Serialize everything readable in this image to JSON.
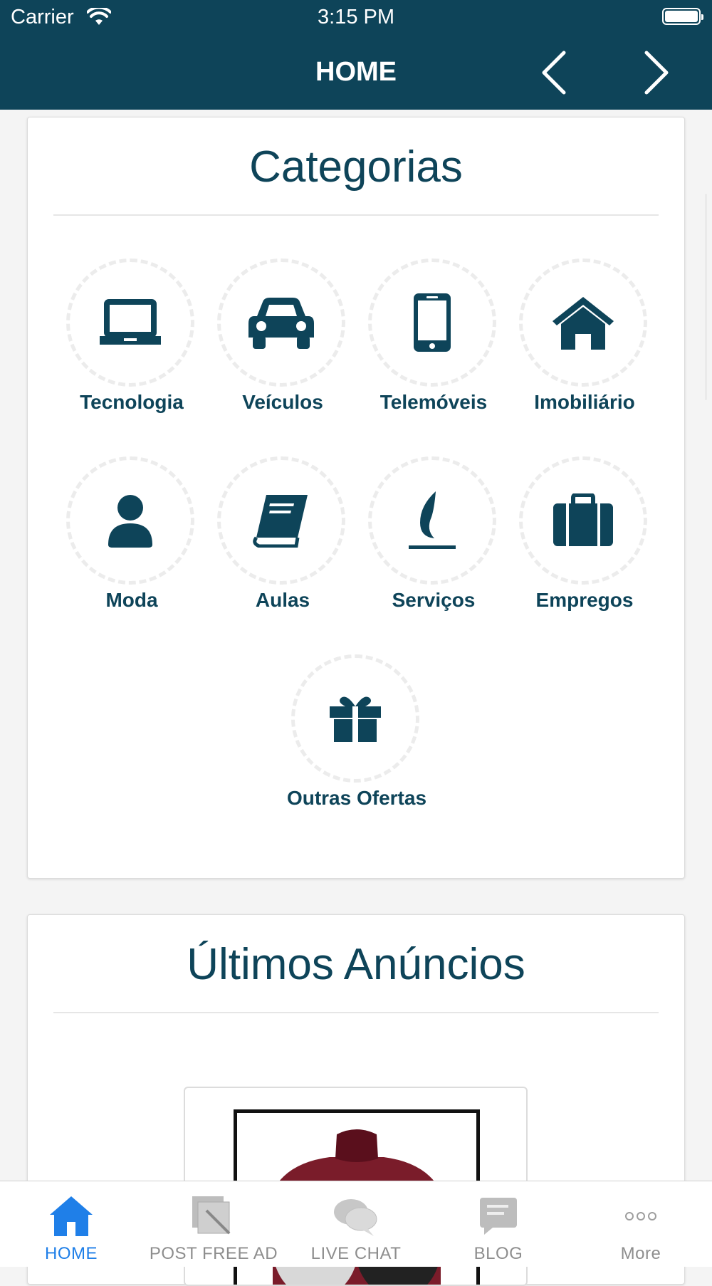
{
  "status_bar": {
    "carrier": "Carrier",
    "time": "3:15 PM"
  },
  "nav": {
    "title": "HOME",
    "prev_icon": "chevron-left-icon",
    "next_icon": "chevron-right-icon"
  },
  "categories": {
    "title": "Categorias",
    "items": [
      {
        "label": "Tecnologia",
        "icon": "laptop-icon"
      },
      {
        "label": "Veículos",
        "icon": "car-icon"
      },
      {
        "label": "Telemóveis",
        "icon": "mobile-phone-icon"
      },
      {
        "label": "Imobiliário",
        "icon": "house-icon"
      },
      {
        "label": "Moda",
        "icon": "user-icon"
      },
      {
        "label": "Aulas",
        "icon": "book-icon"
      },
      {
        "label": "Serviços",
        "icon": "flame-icon"
      },
      {
        "label": "Empregos",
        "icon": "briefcase-icon"
      },
      {
        "label": "Outras Ofertas",
        "icon": "gift-icon"
      }
    ]
  },
  "latest": {
    "title": "Últimos Anúncios"
  },
  "tabbar": {
    "items": [
      {
        "label": "HOME",
        "icon": "home-icon",
        "active": true
      },
      {
        "label": "POST FREE AD",
        "icon": "post-ad-icon",
        "active": false
      },
      {
        "label": "LIVE CHAT",
        "icon": "chat-icon",
        "active": false
      },
      {
        "label": "BLOG",
        "icon": "blog-icon",
        "active": false
      },
      {
        "label": "More",
        "icon": "more-icon",
        "active": false
      }
    ]
  },
  "colors": {
    "primary": "#0e4459",
    "active_tab": "#1f7fe8",
    "inactive_tab": "#8e8e8e"
  }
}
